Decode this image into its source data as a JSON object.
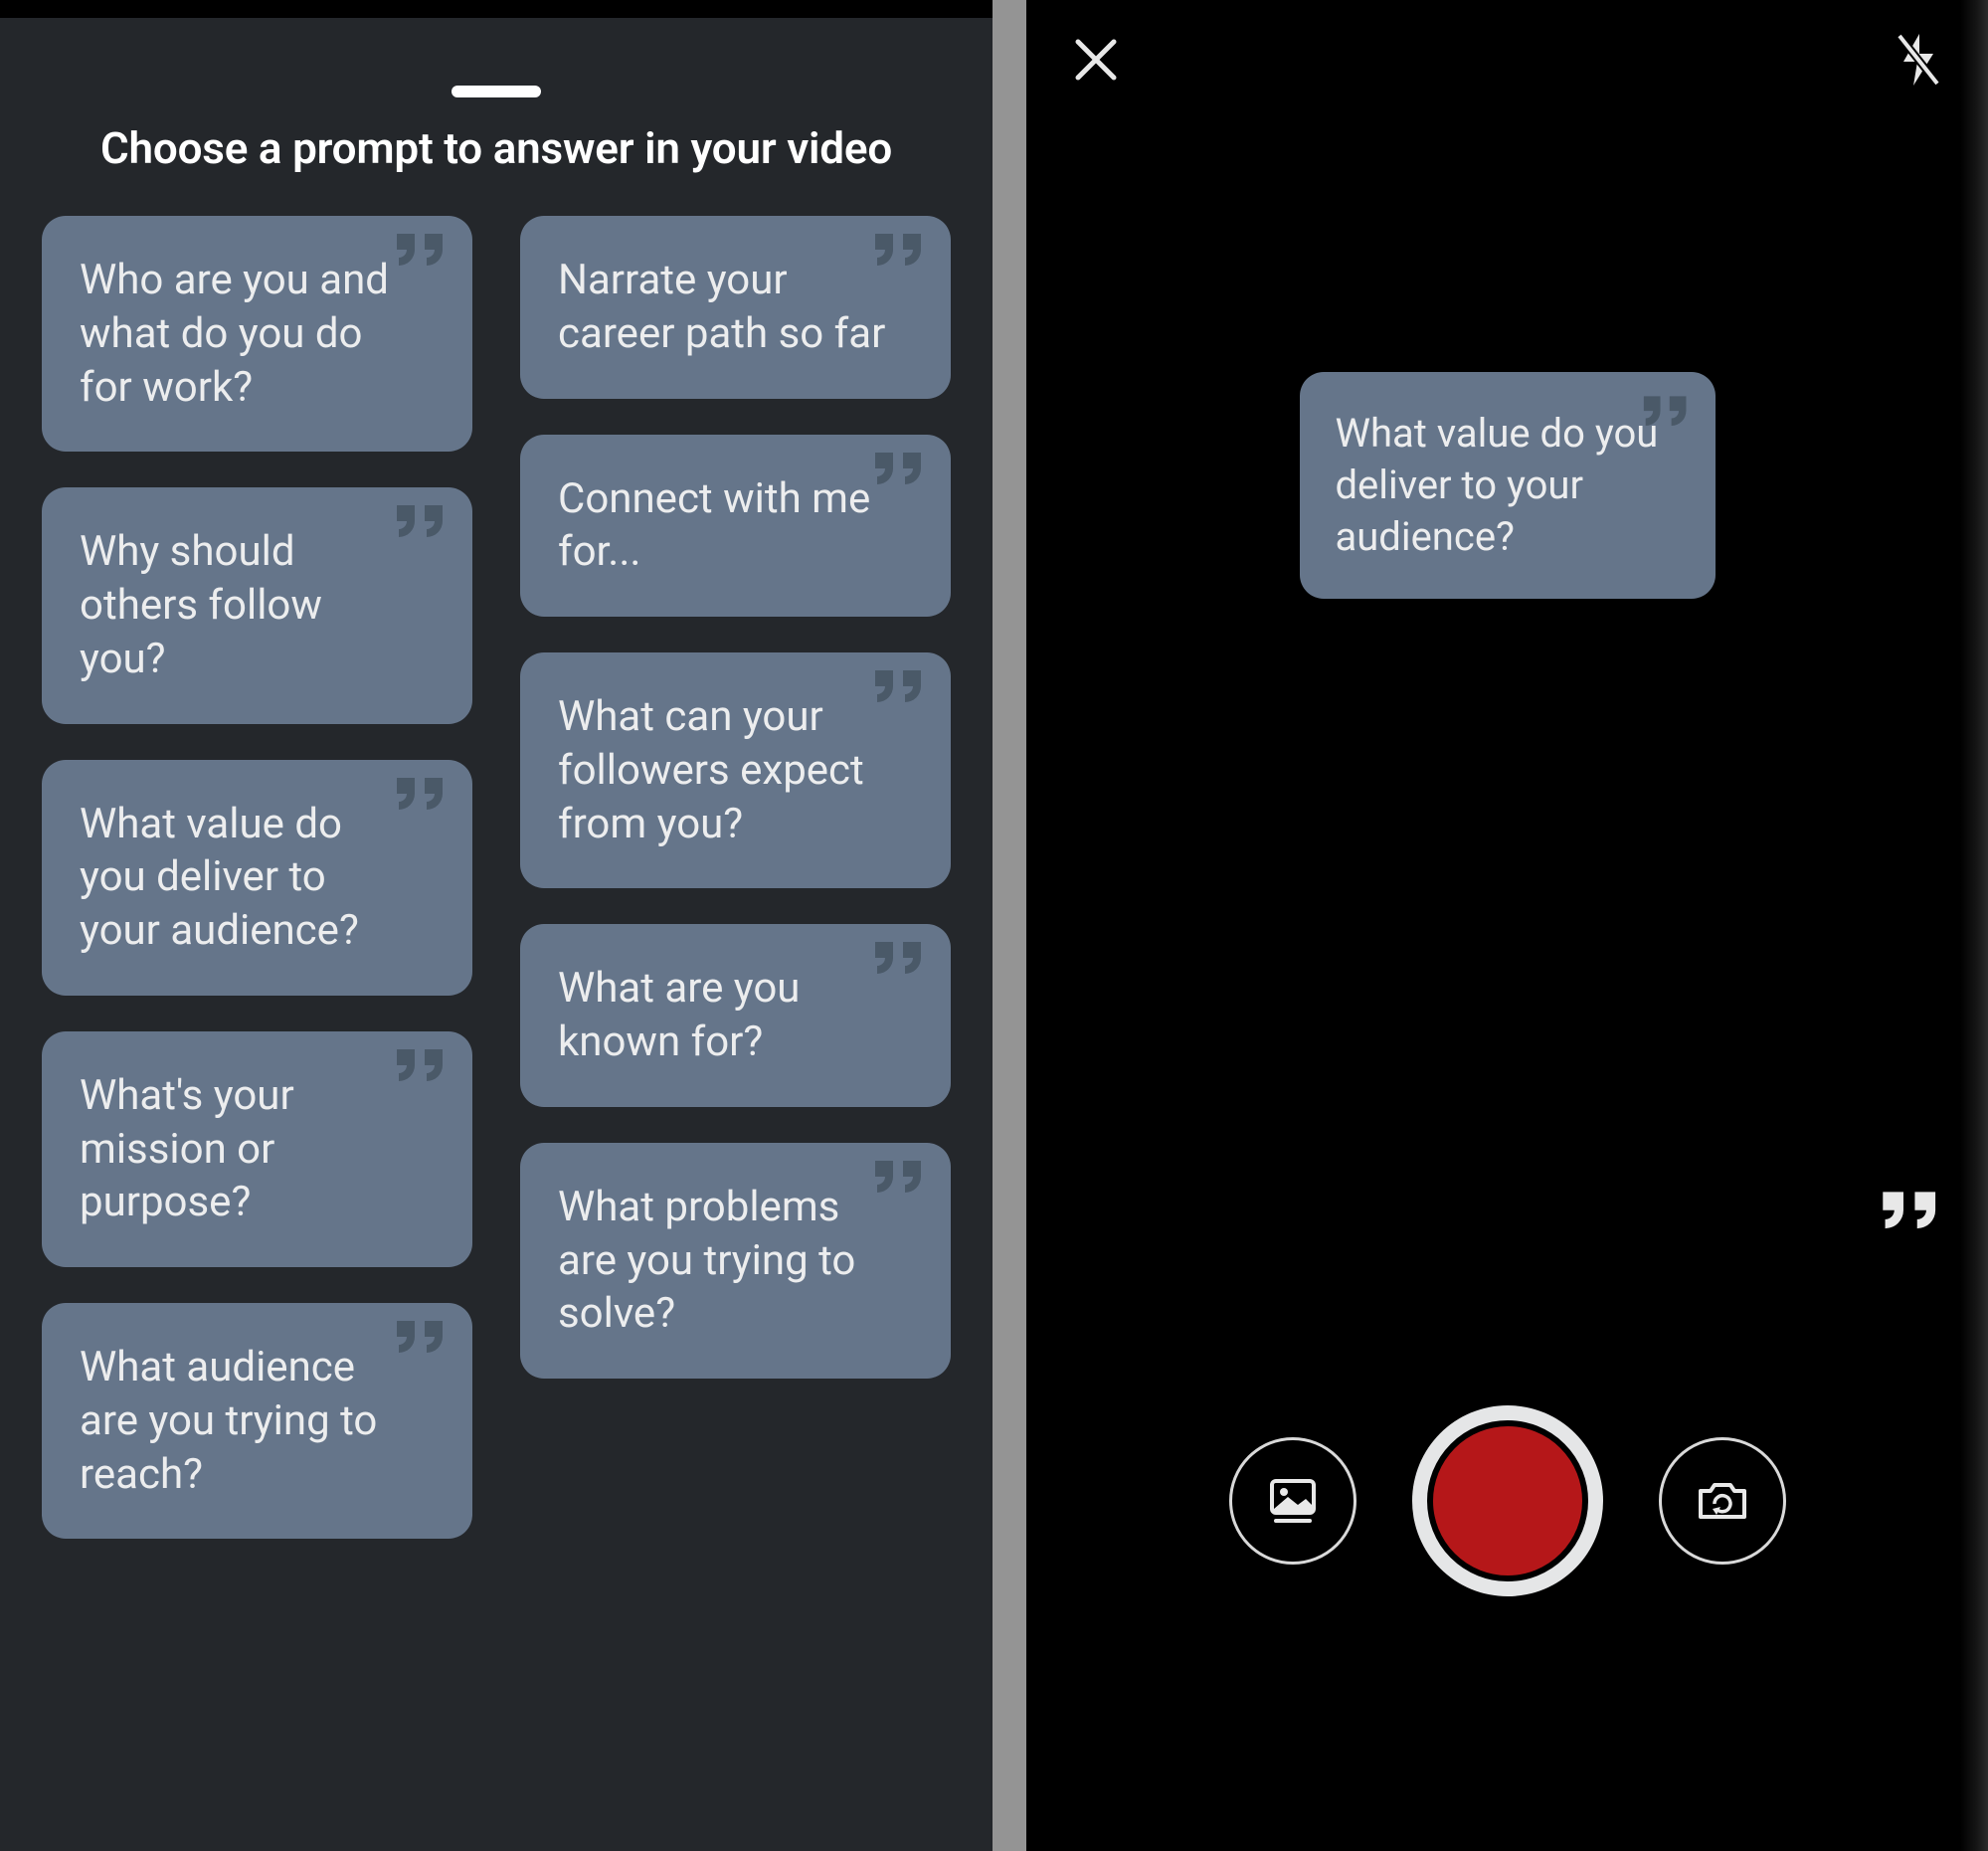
{
  "left": {
    "title": "Choose a prompt to answer in your video",
    "colA": [
      "Who are you and what do you do for work?",
      "Why should others follow you?",
      "What value do you deliver to your audience?",
      "What's your mission or purpose?",
      "What audience are you trying to reach?"
    ],
    "colB": [
      "Narrate your career path so far",
      "Connect with me for...",
      "What can your followers expect from you?",
      "What are you known for?",
      "What problems are you trying to solve?"
    ]
  },
  "right": {
    "selected_prompt": "What value do you de­liver to your audience?"
  },
  "icons": {
    "quote": "quote-icon",
    "close": "close-icon",
    "flash_off": "flash-off-icon",
    "gallery": "gallery-icon",
    "flip": "camera-flip-icon",
    "record": "record-button"
  },
  "colors": {
    "card": "#65758a",
    "panel": "#24272b",
    "record": "#b51719"
  }
}
